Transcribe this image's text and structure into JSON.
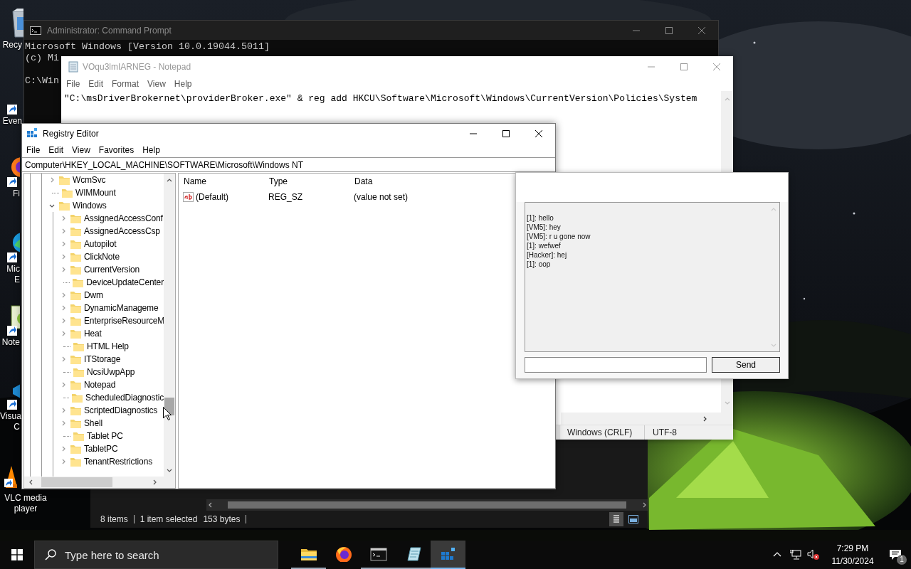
{
  "desktop": {
    "icons": [
      {
        "kind": "recycle-bin",
        "label": [
          "Recy"
        ]
      },
      {
        "kind": "shortcut",
        "label": [
          "Even"
        ]
      },
      {
        "kind": "firefox",
        "label": [
          "Fi"
        ]
      },
      {
        "kind": "edge",
        "label": [
          "Mic",
          "E"
        ]
      },
      {
        "kind": "notepad",
        "label": [
          "Note"
        ]
      },
      {
        "kind": "code",
        "label": [
          "Visua",
          "C"
        ]
      },
      {
        "kind": "vlc",
        "label": [
          "VLC media",
          "player"
        ]
      }
    ]
  },
  "command_prompt": {
    "title": "Administrator: Command Prompt",
    "active": false,
    "output": [
      "Microsoft Windows [Version 10.0.19044.5011]",
      "(c) Mi"
    ],
    "prompt": "C:\\Win"
  },
  "file_explorer": {
    "status": [
      "8 items",
      "1 item selected",
      "153 bytes"
    ],
    "views": [
      {
        "selected": true
      },
      {
        "selected": false
      }
    ]
  },
  "notepad": {
    "title": "VOqu3lmIARNEG - Notepad",
    "active": false,
    "menu": [
      "File",
      "Edit",
      "Format",
      "View",
      "Help"
    ],
    "text": "\"C:\\msDriverBrokernet\\providerBroker.exe\" & reg add HKCU\\Software\\Microsoft\\Windows\\CurrentVersion\\Policies\\System",
    "status": [
      "Windows (CRLF)",
      "UTF-8"
    ]
  },
  "registry_editor": {
    "title": "Registry Editor",
    "active": true,
    "menu": [
      "File",
      "Edit",
      "View",
      "Favorites",
      "Help"
    ],
    "address": "Computer\\HKEY_LOCAL_MACHINE\\SOFTWARE\\Microsoft\\Windows NT",
    "tree": [
      {
        "label": "WcmSvc",
        "has_children": true,
        "expanded": false
      },
      {
        "label": "WIMMount",
        "has_children": false
      },
      {
        "label": "Windows",
        "has_children": true,
        "expanded": true,
        "children": [
          {
            "label": "AssignedAccessConf",
            "has_children": true,
            "expanded": false
          },
          {
            "label": "AssignedAccessCsp",
            "has_children": true,
            "expanded": false
          },
          {
            "label": "Autopilot",
            "has_children": true,
            "expanded": false
          },
          {
            "label": "ClickNote",
            "has_children": true,
            "expanded": false
          },
          {
            "label": "CurrentVersion",
            "has_children": true,
            "expanded": false
          },
          {
            "label": "DeviceUpdateCenter",
            "has_children": false
          },
          {
            "label": "Dwm",
            "has_children": true,
            "expanded": false
          },
          {
            "label": "DynamicManageme",
            "has_children": true,
            "expanded": false
          },
          {
            "label": "EnterpriseResourceM",
            "has_children": true,
            "expanded": false
          },
          {
            "label": "Heat",
            "has_children": true,
            "expanded": false
          },
          {
            "label": "HTML Help",
            "has_children": false
          },
          {
            "label": "ITStorage",
            "has_children": true,
            "expanded": false
          },
          {
            "label": "NcsiUwpApp",
            "has_children": false
          },
          {
            "label": "Notepad",
            "has_children": true,
            "expanded": false
          },
          {
            "label": "ScheduledDiagnostic",
            "has_children": false
          },
          {
            "label": "ScriptedDiagnostics",
            "has_children": true,
            "expanded": false
          },
          {
            "label": "Shell",
            "has_children": true,
            "expanded": false
          },
          {
            "label": "Tablet PC",
            "has_children": false
          },
          {
            "label": "TabletPC",
            "has_children": true,
            "expanded": false
          },
          {
            "label": "TenantRestrictions",
            "has_children": true,
            "expanded": false
          }
        ]
      }
    ],
    "columns": [
      "Name",
      "Type",
      "Data"
    ],
    "values": [
      {
        "name": "(Default)",
        "type": "REG_SZ",
        "data": "(value not set)"
      }
    ]
  },
  "chat_window": {
    "messages": [
      "[1]: hello",
      "[VM5]: hey",
      "[VM5]: r u gone now",
      "[1]: wefwef",
      "[Hacker]: hej",
      "[1]: oop"
    ],
    "send_button": "Send"
  },
  "taskbar": {
    "search": {
      "placeholder": "Type here to search"
    },
    "apps": [
      {
        "kind": "file-explorer",
        "running": true,
        "selected": false
      },
      {
        "kind": "firefox",
        "running": false,
        "selected": false
      },
      {
        "kind": "terminal",
        "running": true,
        "selected": false
      },
      {
        "kind": "notepad",
        "running": true,
        "selected": false
      },
      {
        "kind": "registry",
        "running": true,
        "selected": true
      }
    ],
    "tray": {
      "volume_muted": true,
      "time": "7:29 PM",
      "date": "11/30/2024",
      "notification_count": "1"
    }
  }
}
